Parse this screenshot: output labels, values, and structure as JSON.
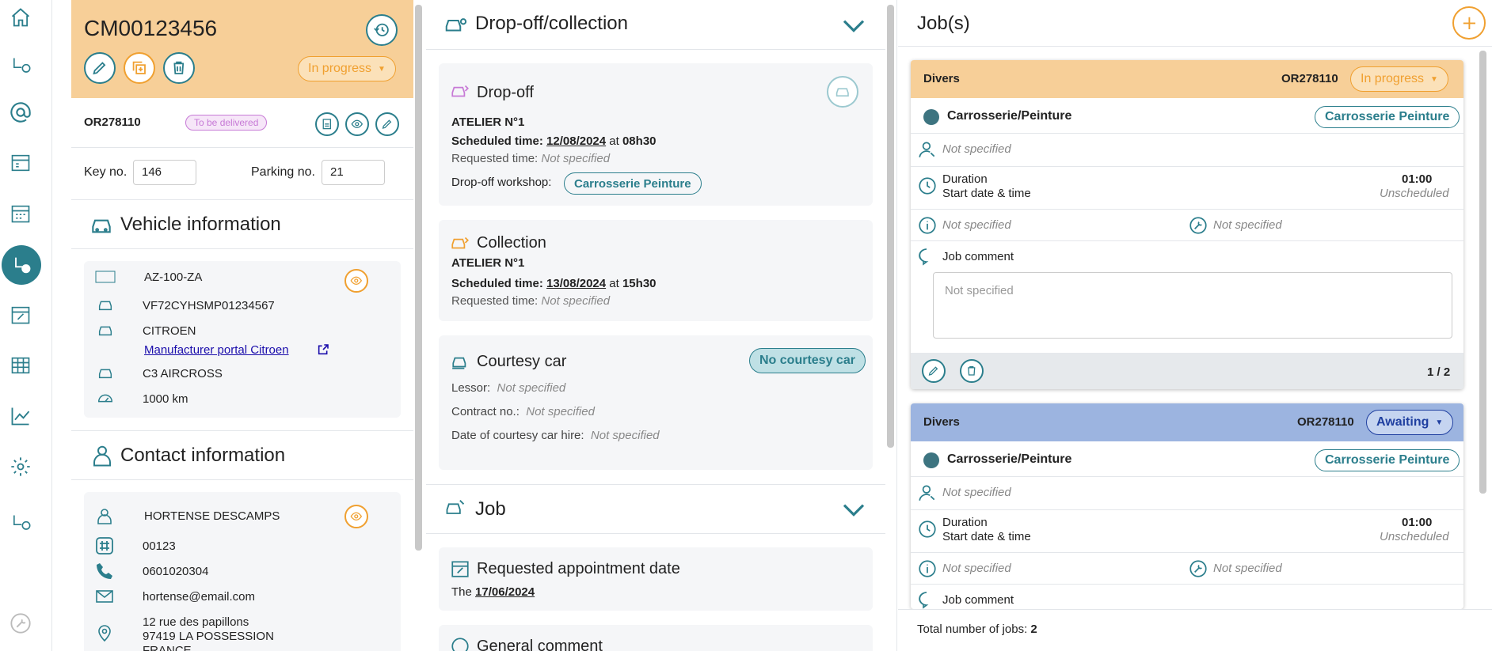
{
  "folder": {
    "number": "CM00123456",
    "status": "In progress"
  },
  "order": {
    "number": "OR278110",
    "badge": "To be delivered"
  },
  "key": {
    "label": "Key no.",
    "value": "146"
  },
  "parking": {
    "label": "Parking no.",
    "value": "21"
  },
  "vehicle": {
    "title": "Vehicle information",
    "plate": "AZ-100-ZA",
    "vin": "VF72CYHSMP01234567",
    "brand": "CITROEN",
    "portal": "Manufacturer portal Citroen",
    "model": "C3 AIRCROSS",
    "mileage": "1000 km"
  },
  "contact": {
    "title": "Contact information",
    "name": "HORTENSE DESCAMPS",
    "id": "00123",
    "phone": "0601020304",
    "email": "hortense@email.com",
    "addr1": "12 rue des papillons",
    "addr2": "97419 LA POSSESSION",
    "addr3": "FRANCE"
  },
  "dropcol": {
    "title": "Drop-off/collection"
  },
  "dropoff": {
    "title": "Drop-off",
    "workshop_name": "ATELIER N°1",
    "sched_label": "Scheduled time:",
    "sched_date": "12/08/2024",
    "at": "at",
    "sched_time": "08h30",
    "req_label": "Requested time:",
    "req_value": "Not specified",
    "ws_label": "Drop-off workshop:",
    "ws_value": "Carrosserie Peinture"
  },
  "collection": {
    "title": "Collection",
    "workshop_name": "ATELIER N°1",
    "sched_label": "Scheduled time:",
    "sched_date": "13/08/2024",
    "at": "at",
    "sched_time": "15h30",
    "req_label": "Requested time:",
    "req_value": "Not specified"
  },
  "courtesy": {
    "title": "Courtesy car",
    "badge": "No courtesy car",
    "lessor_label": "Lessor:",
    "lessor_value": "Not specified",
    "contract_label": "Contract no.:",
    "contract_value": "Not specified",
    "date_label": "Date of courtesy car hire:",
    "date_value": "Not specified"
  },
  "job": {
    "title": "Job",
    "req_title": "Requested appointment date",
    "req_prefix": "The",
    "req_date": "17/06/2024",
    "comment_title": "General comment"
  },
  "jobs": {
    "title": "Job(s)",
    "total_label": "Total number of jobs:",
    "total": "2",
    "items": [
      {
        "type": "Divers",
        "order": "OR278110",
        "status": "In progress",
        "category": "Carrosserie/Peinture",
        "workshop": "Carrosserie Peinture",
        "assignee": "Not specified",
        "duration_label": "Duration",
        "duration": "01:00",
        "start_label": "Start date & time",
        "start": "Unscheduled",
        "info": "Not specified",
        "tool": "Not specified",
        "comment_label": "Job comment",
        "comment_placeholder": "Not specified",
        "pager": "1 / 2"
      },
      {
        "type": "Divers",
        "order": "OR278110",
        "status": "Awaiting",
        "category": "Carrosserie/Peinture",
        "workshop": "Carrosserie Peinture",
        "assignee": "Not specified",
        "duration_label": "Duration",
        "duration": "01:00",
        "start_label": "Start date & time",
        "start": "Unscheduled",
        "info": "Not specified",
        "tool": "Not specified",
        "comment_label": "Job comment"
      }
    ]
  },
  "colors": {
    "teal": "#2b7e8c",
    "orange": "#f0a030",
    "header_orange": "#f7cf98",
    "awaiting_blue": "#9cb4e0",
    "badge_purple": "#c77ad6"
  }
}
